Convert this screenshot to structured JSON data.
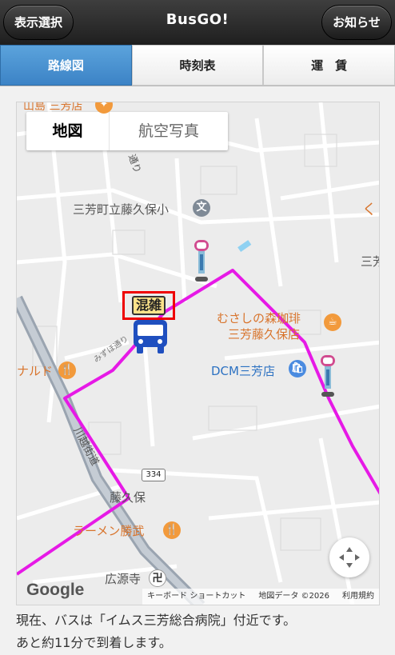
{
  "header": {
    "left_button": "表示選択",
    "title": "BusGO!",
    "right_button": "お知らせ"
  },
  "tabs": [
    {
      "label": "路線図",
      "active": true
    },
    {
      "label": "時刻表",
      "active": false
    },
    {
      "label": "運　賃",
      "active": false
    }
  ],
  "map": {
    "type_buttons": [
      "地図",
      "航空写真"
    ],
    "labels": {
      "l1": "山島 三芳店",
      "l2": "三芳町立藤久保小",
      "l3": "むさしの森珈琲",
      "l4": "三芳藤久保店",
      "l5": "DCM三芳店",
      "l6": "ナルド",
      "l7": "藤久保",
      "l8": "ラーメン勝武",
      "l9": "広源寺",
      "l10": "三芳",
      "l11": "334",
      "road1": "川越街道",
      "road2": "みずほ通り",
      "road3": "通り"
    },
    "congestion_label": "混雑",
    "google_logo": "Google",
    "attribution": [
      "キーボード ショートカット",
      "地図データ ©2026",
      "利用規約"
    ],
    "route_color": "#e619e6"
  },
  "status": {
    "line1": "現在、バスは「イムス三芳総合病院」付近です。",
    "line2": "あと約11分で到着します。"
  }
}
